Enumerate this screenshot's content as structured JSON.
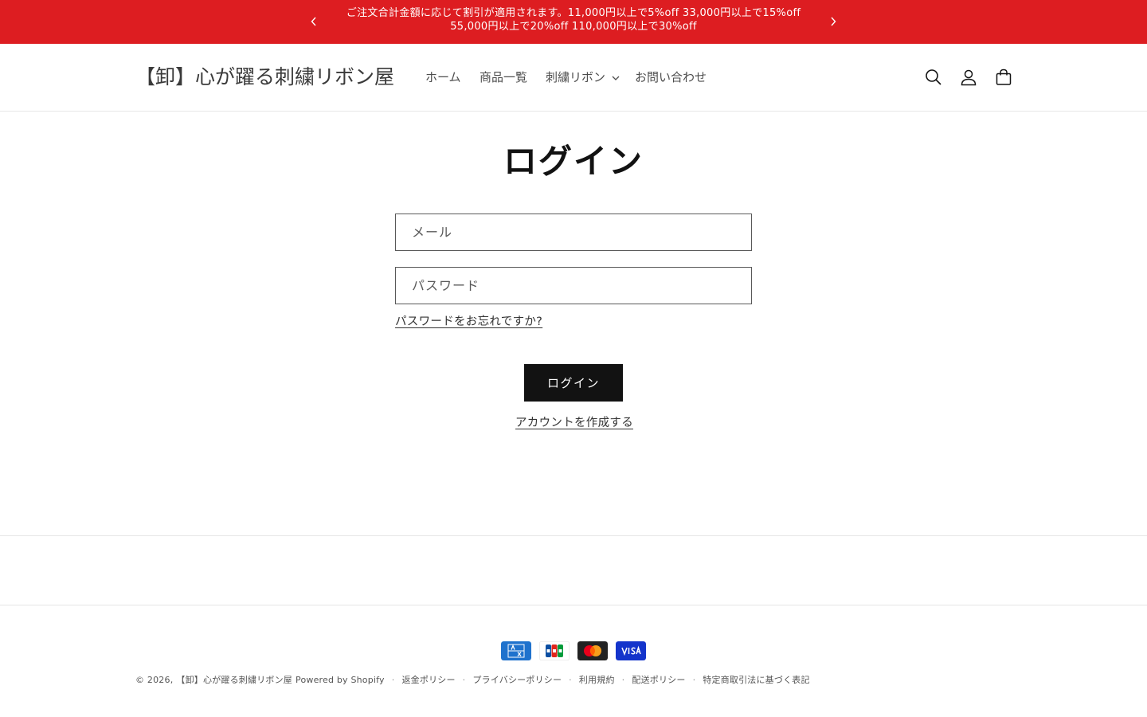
{
  "announcement": {
    "line1": "ご注文合計金額に応じて割引が適用されます。11,000円以上で5%off 33,000円以上で15%off",
    "line2": "55,000円以上で20%off 110,000円以上で30%off"
  },
  "header": {
    "logo": "【卸】心が躍る刺繍リボン屋",
    "nav": [
      "ホーム",
      "商品一覧",
      "刺繍リボン",
      "お問い合わせ"
    ]
  },
  "login": {
    "title": "ログイン",
    "email_placeholder": "メール",
    "password_placeholder": "パスワード",
    "forgot_link": "パスワードをお忘れですか?",
    "submit_label": "ログイン",
    "create_account_link": "アカウントを作成する"
  },
  "footer": {
    "copyright": "© 2026,",
    "store_name": "【卸】心が躍る刺繍リボン屋",
    "powered_by": "Powered by Shopify",
    "policies": [
      "返金ポリシー",
      "プライバシーポリシー",
      "利用規約",
      "配送ポリシー",
      "特定商取引法に基づく表記"
    ],
    "payment_methods": [
      "american-express-icon",
      "jcb-icon",
      "mastercard-icon",
      "visa-icon"
    ]
  },
  "colors": {
    "announcement_bg": "#dd1d21",
    "button_bg": "#121212"
  }
}
